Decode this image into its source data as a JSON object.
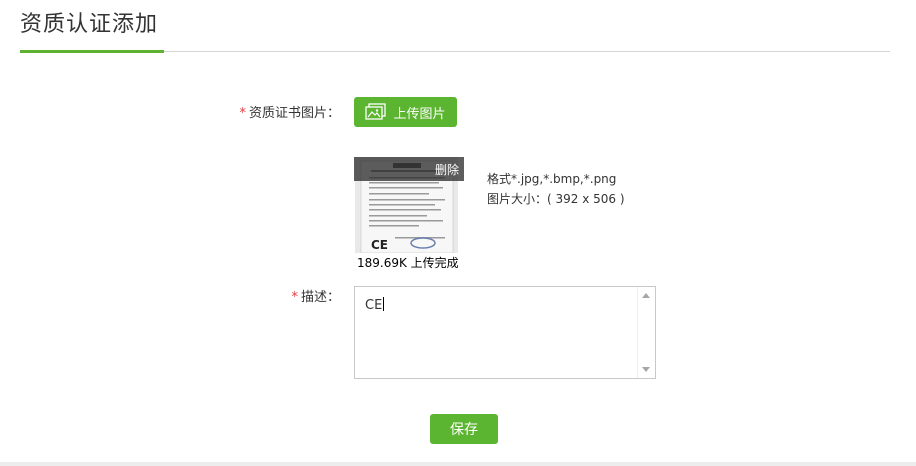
{
  "header": {
    "title": "资质认证添加"
  },
  "form": {
    "required_mark": "*",
    "cert_image_label": "资质证书图片：",
    "upload_button": "上传图片",
    "thumbnail": {
      "delete_label": "删除",
      "status": "189.69K 上传完成"
    },
    "format_hint": "格式*.jpg,*.bmp,*.png",
    "size_hint": "图片大小：( 392 x 506 )",
    "description_label": "描述：",
    "description_value": "CE",
    "save_button": "保存"
  },
  "colors": {
    "accent": "#5cb531",
    "required": "#e4393c"
  }
}
